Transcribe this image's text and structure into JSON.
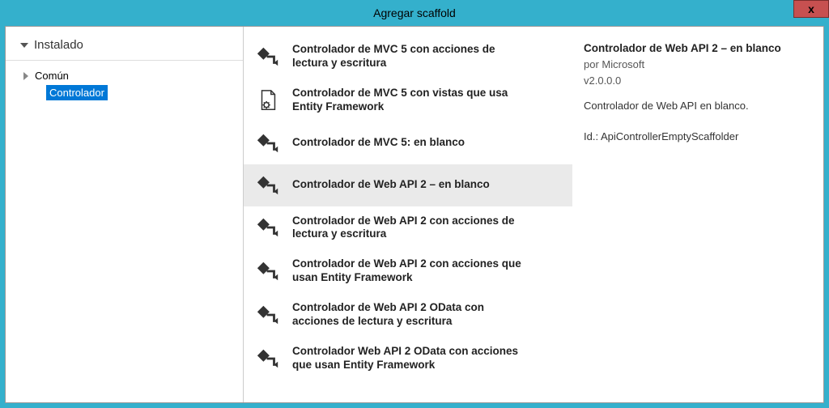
{
  "titlebar": {
    "title": "Agregar scaffold",
    "close": "x"
  },
  "sidebar": {
    "header": "Instalado",
    "items": [
      {
        "label": "Común",
        "expanded": false
      },
      {
        "label": "Controlador",
        "selected": true
      }
    ]
  },
  "scaffolds": [
    {
      "label": "Controlador de MVC 5 con acciones de lectura y escritura",
      "icon": "controller"
    },
    {
      "label": "Controlador de MVC 5 con vistas que usa Entity Framework",
      "icon": "file-gear"
    },
    {
      "label": "Controlador de MVC 5: en blanco",
      "icon": "controller"
    },
    {
      "label": "Controlador de Web API 2 – en blanco",
      "icon": "controller",
      "selected": true
    },
    {
      "label": "Controlador de Web API 2 con acciones de lectura y escritura",
      "icon": "controller"
    },
    {
      "label": "Controlador de Web API 2 con acciones que usan Entity Framework",
      "icon": "controller"
    },
    {
      "label": "Controlador de Web API 2 OData con acciones de lectura y escritura",
      "icon": "controller"
    },
    {
      "label": "Controlador Web API 2 OData con acciones que usan Entity Framework",
      "icon": "controller"
    }
  ],
  "detail": {
    "title": "Controlador de Web API 2 – en blanco",
    "by": "por Microsoft",
    "version": "v2.0.0.0",
    "description": "Controlador de Web API en blanco.",
    "id_label": "Id.:",
    "id_value": "ApiControllerEmptyScaffolder"
  }
}
